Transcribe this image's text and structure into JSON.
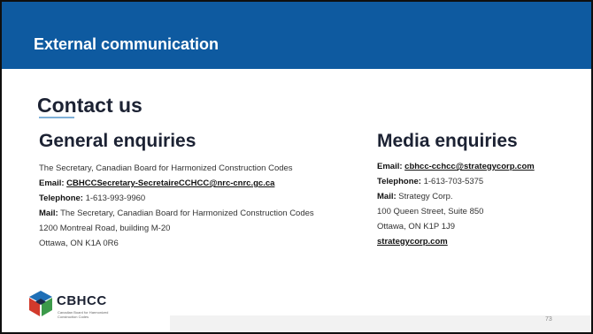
{
  "banner": {
    "title": "External communication"
  },
  "contact": {
    "title": "Contact us"
  },
  "general": {
    "heading": "General enquiries",
    "line1": "The Secretary, Canadian Board for Harmonized Construction Codes",
    "email_label": "Email:",
    "email_value": "CBHCCSecretary-SecretaireCCHCC@nrc-cnrc.gc.ca",
    "phone_label": "Telephone:",
    "phone_value": "1-613-993-9960",
    "mail_label": "Mail:",
    "mail_value": "The Secretary, Canadian Board for Harmonized Construction Codes",
    "address1": "1200 Montreal Road, building M-20",
    "address2": "Ottawa, ON K1A 0R6"
  },
  "media": {
    "heading": "Media enquiries",
    "email_label": "Email:",
    "email_value": "cbhcc-cchcc@strategycorp.com",
    "phone_label": "Telephone:",
    "phone_value": "1-613-703-5375",
    "mail_label": "Mail:",
    "mail_value": "Strategy Corp.",
    "address1": "100 Queen Street, Suite 850",
    "address2": "Ottawa, ON K1P 1J9",
    "website": "strategycorp.com"
  },
  "logo": {
    "name": "CBHCC",
    "subtitle": "Canadian Board for Harmonized Construction Codes"
  },
  "page": {
    "number": "73"
  },
  "colors": {
    "banner": "#0e5aa0",
    "logo_blue": "#1f6fb6",
    "logo_green": "#3c9a4a",
    "logo_red": "#d23a2c",
    "logo_navy": "#1c2a4a"
  }
}
